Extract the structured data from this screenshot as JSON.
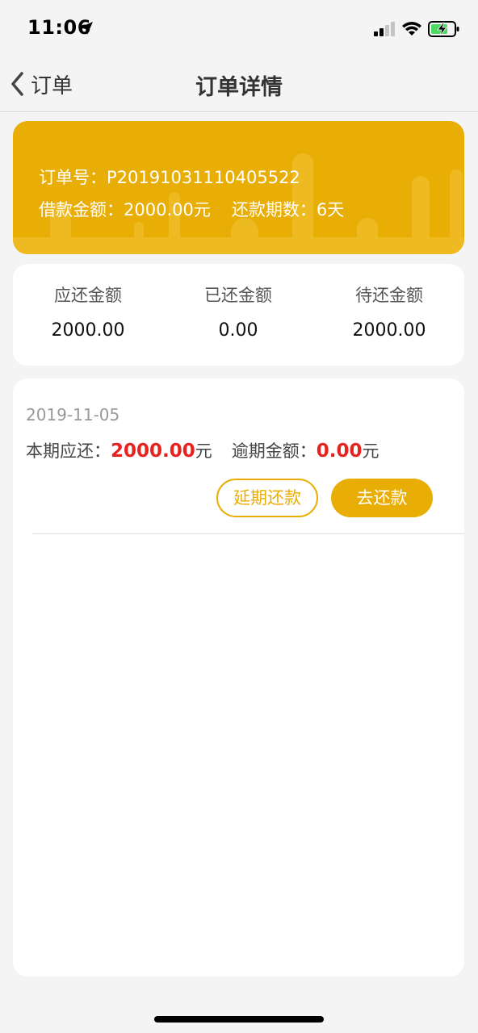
{
  "status_bar": {
    "time": "11:06",
    "icons": [
      "location-arrow-icon",
      "cellular-signal-icon",
      "wifi-icon",
      "battery-charging-icon"
    ],
    "battery_color": "#4cd964"
  },
  "nav": {
    "back_label": "订单",
    "title": "订单详情"
  },
  "order": {
    "number_label": "订单号：",
    "number": "P20191031110405522",
    "loan_amount_label": "借款金额：",
    "loan_amount": "2000.00元",
    "periods_label": "还款期数：",
    "periods": "6天"
  },
  "summary": {
    "due_label": "应还金额",
    "due_value": "2000.00",
    "repaid_label": "已还金额",
    "repaid_value": "0.00",
    "pending_label": "待还金额",
    "pending_value": "2000.00"
  },
  "bill": {
    "date": "2019-11-05",
    "current_due_label": "本期应还：",
    "current_due_value": "2000.00",
    "current_due_unit": "元",
    "overdue_label": "逾期金额：",
    "overdue_value": "0.00",
    "overdue_unit": "元",
    "defer_button": "延期还款",
    "repay_button": "去还款"
  },
  "colors": {
    "accent": "#e9ae05",
    "highlight_red": "#e6231e",
    "background": "#f4f4f4"
  }
}
